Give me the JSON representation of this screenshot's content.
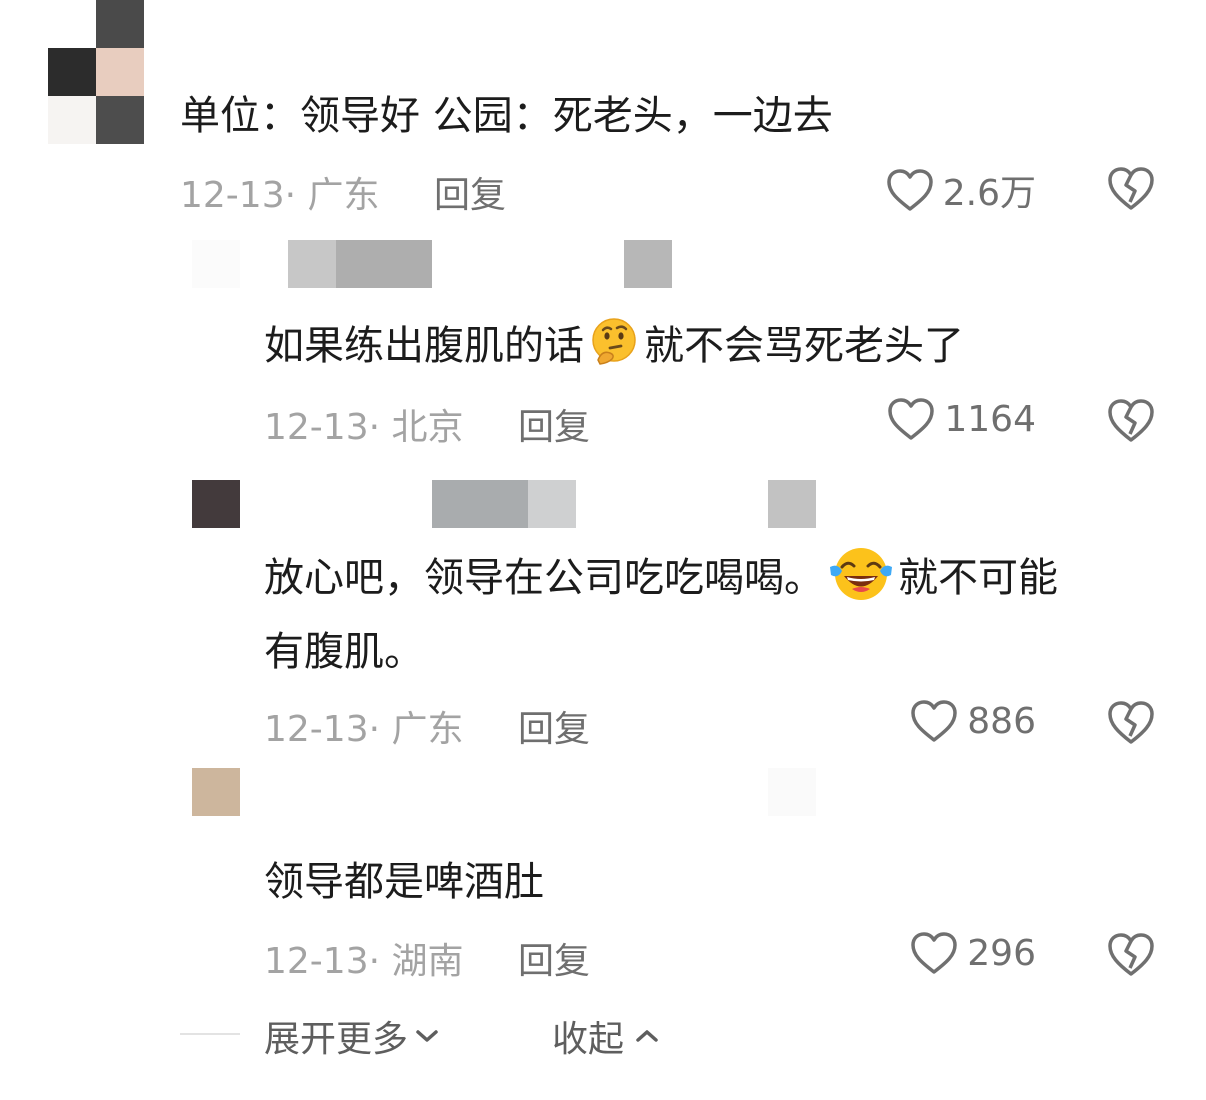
{
  "comment": {
    "text": "单位：领导好   公园：死老头，一边去",
    "meta": "12-13· 广东",
    "reply_label": "回复",
    "likes": "2.6万"
  },
  "replies": [
    {
      "text_before": "如果练出腹肌的话",
      "emoji": "thinking-face",
      "text_after": "就不会骂死老头了",
      "meta": "12-13· 北京",
      "reply_label": "回复",
      "likes": "1164"
    },
    {
      "text_line1_before": "放心吧，领导在公司吃吃喝喝。",
      "emoji": "tears-of-joy",
      "text_line1_after": "就不可能",
      "text_line2": "有腹肌。",
      "meta": "12-13· 广东",
      "reply_label": "回复",
      "likes": "886"
    },
    {
      "text": "领导都是啤酒肚",
      "meta": "12-13· 湖南",
      "reply_label": "回复",
      "likes": "296"
    }
  ],
  "footer": {
    "expand_label": "展开更多",
    "collapse_label": "收起"
  },
  "colors": {
    "text": "#1c1c1c",
    "meta": "#a3a3a3",
    "secondary": "#6f6f6f"
  }
}
